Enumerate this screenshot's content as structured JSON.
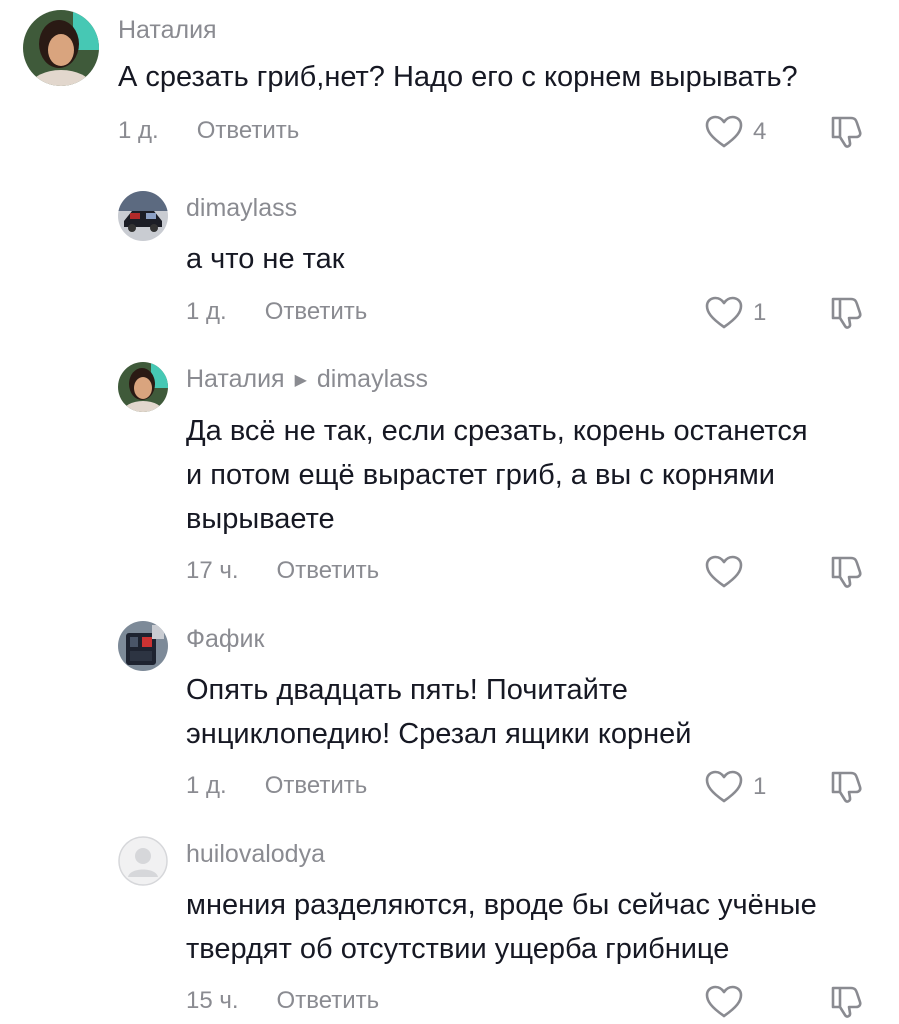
{
  "colors": {
    "meta": "#8a8b91",
    "text": "#161823",
    "icon": "#8a8b91"
  },
  "comments": [
    {
      "username": "Наталия",
      "text_lines": [
        "А срезать гриб,нет? Надо его с корнем вырывать?"
      ],
      "time": "1 д.",
      "reply_label": "Ответить",
      "likes": "4",
      "avatar_icon": "profile-photo-woman"
    },
    {
      "username": "dimaylass",
      "text_lines": [
        "а что не так"
      ],
      "time": "1 д.",
      "reply_label": "Ответить",
      "likes": "1",
      "avatar_icon": "profile-photo-car"
    },
    {
      "username": "Наталия",
      "reply_to": "dimaylass",
      "text_lines": [
        "Да всё не так, если срезать, корень останется",
        "и потом ещё вырастет гриб, а вы с корнями",
        "вырываете"
      ],
      "time": "17 ч.",
      "reply_label": "Ответить",
      "likes": "",
      "avatar_icon": "profile-photo-woman"
    },
    {
      "username": "Фафик",
      "text_lines": [
        "Опять двадцать пять! Почитайте",
        "энциклопедию! Срезал ящики корней"
      ],
      "time": "1 д.",
      "reply_label": "Ответить",
      "likes": "1",
      "avatar_icon": "profile-photo-device"
    },
    {
      "username": "huilovalodya",
      "text_lines": [
        "мнения разделяются, вроде бы сейчас учёные",
        "твердят об отсутствии ущерба грибнице"
      ],
      "time": "15 ч.",
      "reply_label": "Ответить",
      "likes": "",
      "avatar_icon": "default-avatar"
    }
  ]
}
